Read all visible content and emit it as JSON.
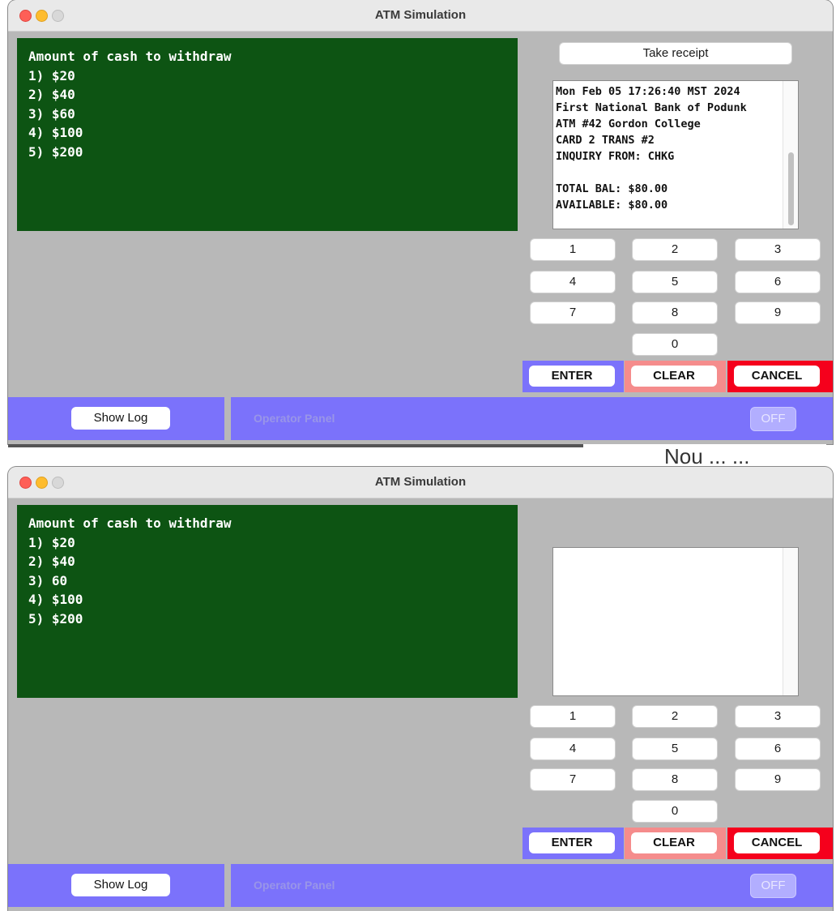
{
  "windows": [
    {
      "title": "ATM Simulation",
      "screen_lines": [
        "Amount of cash to withdraw",
        "1) $20",
        "2) $40",
        "3) $60",
        "4) $100",
        "5) $200"
      ],
      "take_receipt_label": "Take receipt",
      "receipt_lines": [
        "Mon Feb 05 17:26:40 MST 2024",
        "First National Bank of Podunk",
        "ATM #42 Gordon College",
        "CARD 2 TRANS #2",
        "INQUIRY FROM: CHKG",
        "",
        "TOTAL BAL: $80.00",
        "AVAILABLE: $80.00"
      ],
      "keys": [
        "1",
        "2",
        "3",
        "4",
        "5",
        "6",
        "7",
        "8",
        "9",
        "0"
      ],
      "enter_label": "ENTER",
      "clear_label": "CLEAR",
      "cancel_label": "CANCEL",
      "show_log_label": "Show Log",
      "operator_panel_label": "Operator Panel",
      "off_label": "OFF"
    },
    {
      "title": "ATM Simulation",
      "screen_lines": [
        "Amount of cash to withdraw",
        "1) $20",
        "2) $40",
        "3) 60",
        "4) $100",
        "5) $200"
      ],
      "receipt_lines": [],
      "keys": [
        "1",
        "2",
        "3",
        "4",
        "5",
        "6",
        "7",
        "8",
        "9",
        "0"
      ],
      "enter_label": "ENTER",
      "clear_label": "CLEAR",
      "cancel_label": "CANCEL",
      "show_log_label": "Show Log",
      "operator_panel_label": "Operator Panel",
      "off_label": "OFF"
    }
  ],
  "background_text": "Nou ... ...",
  "colors": {
    "screen_bg": "#0d5413",
    "panel_bg": "#b8b8b8",
    "operator_bar": "#7b72fb",
    "enter_bg": "#7b72fb",
    "clear_bg": "#f58c8c",
    "cancel_bg": "#f5001c"
  }
}
